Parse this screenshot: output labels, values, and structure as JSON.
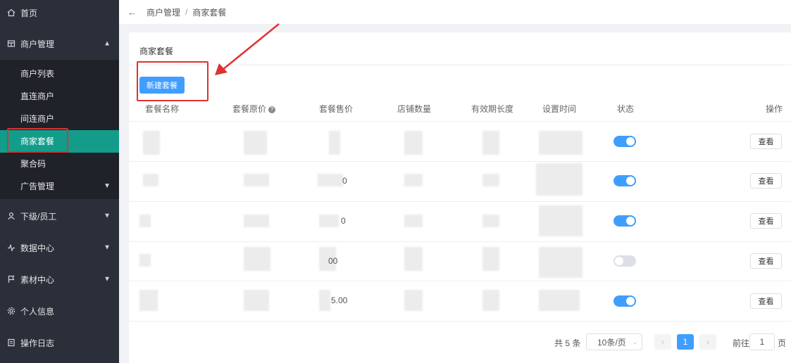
{
  "sidebar": {
    "home": "首页",
    "merchant_mgmt": "商户管理",
    "sub_items": [
      "商户列表",
      "直连商户",
      "间连商户",
      "商家套餐",
      "聚合码",
      "广告管理"
    ],
    "staff": "下级/员工",
    "data_center": "数据中心",
    "material_center": "素材中心",
    "profile": "个人信息",
    "op_log": "操作日志"
  },
  "breadcrumb": {
    "parent": "商户管理",
    "separator": "/",
    "current": "商家套餐"
  },
  "card": {
    "title": "商家套餐",
    "create_label": "新建套餐"
  },
  "table": {
    "headers": [
      "套餐名称",
      "套餐原价",
      "套餐售价",
      "店铺数量",
      "有效期长度",
      "设置时间",
      "状态",
      "操作"
    ],
    "rows": [
      {
        "price_fragment": "",
        "status_on": true,
        "action": "查看"
      },
      {
        "price_fragment": "0",
        "status_on": true,
        "action": "查看"
      },
      {
        "price_fragment": "0",
        "status_on": true,
        "action": "查看"
      },
      {
        "price_fragment": "00",
        "status_on": false,
        "action": "查看"
      },
      {
        "price_fragment": "5.00",
        "status_on": true,
        "action": "查看"
      }
    ]
  },
  "pagination": {
    "total": "共 5 条",
    "page_size": "10条/页",
    "current": "1",
    "goto_label": "前往",
    "goto_value": "1",
    "page_unit": "页"
  },
  "colors": {
    "accent": "#409eff",
    "active_menu": "#139c8a",
    "highlight": "#e03131"
  }
}
